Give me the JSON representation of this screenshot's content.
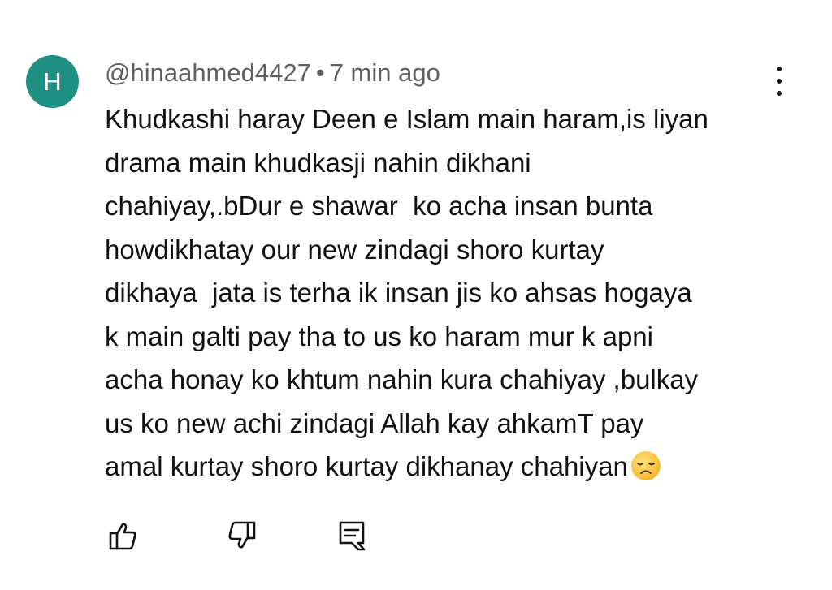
{
  "comment": {
    "avatar_letter": "H",
    "avatar_color": "#1f8f83",
    "author": "@hinaahmed4427",
    "separator": "•",
    "time": "7 min ago",
    "body_lines": [
      "Khudkashi haray Deen e Islam main haram,is liyan",
      "drama main khudkasji nahin dikhani",
      "chahiyay,.bDur e shawar  ko acha insan bunta",
      "howdikhatay our new zindagi shoro kurtay",
      "dikhaya  jata is terha ik insan jis ko ahsas hogaya",
      "k main galti pay tha to us ko haram mur k apni",
      "acha honay ko khtum nahin kura chahiyay ,bulkay",
      "us ko new achi zindagi Allah kay ahkamT pay",
      "amal kurtay shoro kurtay dikhanay chahiyan"
    ],
    "trailing_emoji": "disappointed-face-emoji"
  },
  "actions": {
    "like_icon": "thumbs-up-icon",
    "dislike_icon": "thumbs-down-icon",
    "reply_icon": "reply-comment-icon",
    "more_icon": "more-vertical-icon"
  }
}
